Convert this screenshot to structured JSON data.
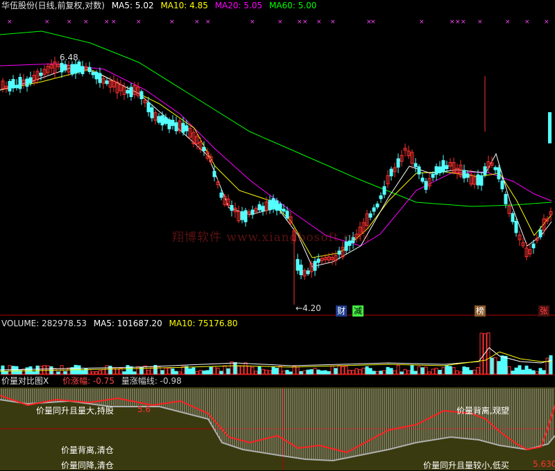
{
  "main": {
    "title": "华伍股份(日线,前复权,对数)",
    "ma5_label": "MA5: 5.02",
    "ma10_label": "MA10: 4.85",
    "ma20_label": "MA20: 5.05",
    "ma60_label": "MA60: 5.00",
    "high_label": "6.48",
    "low_label": "4.20",
    "tags": [
      "财",
      "减",
      "榜",
      "张"
    ],
    "watermark": "翔博软件 www.xiangbosoft.com"
  },
  "volume": {
    "vol_label": "VOLUME: 282978.53",
    "ma5_label": "MA5: 101687.20",
    "ma10_label": "MA10: 75176.80"
  },
  "indicator": {
    "title": "价量对比图X",
    "price_label": "价涨幅: -0.75",
    "vol_label": "量涨幅线: -0.98",
    "notes": [
      "价量同升且量大,持股",
      "价量背离,观望",
      "价量背离,清仓",
      "价量同降,清仓",
      "价量同升且量较小,低买"
    ],
    "value_left": "5.6",
    "value_right": "5.630"
  },
  "colors": {
    "up": "#ff3232",
    "down": "#54ffff",
    "ma5": "#ffffff",
    "ma10": "#ffff00",
    "ma20": "#ff00ff",
    "ma60": "#00ff00",
    "grid": "#b00000"
  },
  "chart_data": {
    "type": "candlestick",
    "price_range": [
      4.2,
      6.48
    ],
    "ma_lines": [
      "MA5",
      "MA10",
      "MA20",
      "MA60"
    ],
    "latest": {
      "MA5": 5.02,
      "MA10": 4.85,
      "MA20": 5.05,
      "MA60": 5.0
    }
  }
}
